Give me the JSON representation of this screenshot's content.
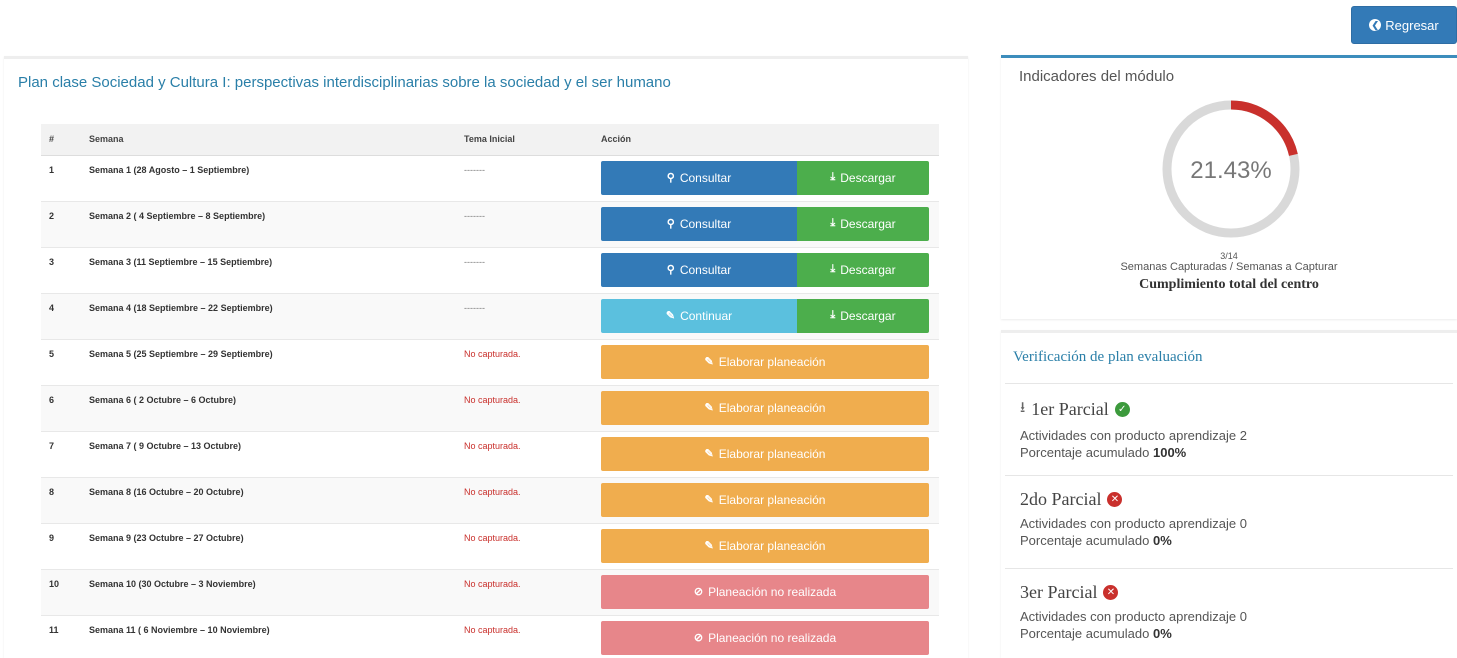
{
  "header": {
    "back_label": "Regresar"
  },
  "plan": {
    "title": "Plan clase Sociedad y Cultura I: perspectivas interdisciplinarias sobre la sociedad y el ser humano",
    "columns": [
      "#",
      "Semana",
      "Tema Inicial",
      "Acción"
    ],
    "rows": [
      {
        "num": "1",
        "semana": "Semana 1 (28 Agosto – 1 Septiembre)",
        "tema": "-------",
        "actions": [
          "consultar",
          "descargar"
        ]
      },
      {
        "num": "2",
        "semana": "Semana 2 ( 4 Septiembre – 8 Septiembre)",
        "tema": "-------",
        "actions": [
          "consultar",
          "descargar"
        ]
      },
      {
        "num": "3",
        "semana": "Semana 3 (11 Septiembre – 15 Septiembre)",
        "tema": "-------",
        "actions": [
          "consultar",
          "descargar"
        ]
      },
      {
        "num": "4",
        "semana": "Semana 4 (18 Septiembre – 22 Septiembre)",
        "tema": "-------",
        "actions": [
          "continuar",
          "descargar"
        ]
      },
      {
        "num": "5",
        "semana": "Semana 5 (25 Septiembre – 29 Septiembre)",
        "tema": "No capturada.",
        "actions": [
          "elaborar"
        ]
      },
      {
        "num": "6",
        "semana": "Semana 6 ( 2 Octubre – 6 Octubre)",
        "tema": "No capturada.",
        "actions": [
          "elaborar"
        ]
      },
      {
        "num": "7",
        "semana": "Semana 7 ( 9 Octubre – 13 Octubre)",
        "tema": "No capturada.",
        "actions": [
          "elaborar"
        ]
      },
      {
        "num": "8",
        "semana": "Semana 8 (16 Octubre – 20 Octubre)",
        "tema": "No capturada.",
        "actions": [
          "elaborar"
        ]
      },
      {
        "num": "9",
        "semana": "Semana 9 (23 Octubre – 27 Octubre)",
        "tema": "No capturada.",
        "actions": [
          "elaborar"
        ]
      },
      {
        "num": "10",
        "semana": "Semana 10 (30 Octubre – 3 Noviembre)",
        "tema": "No capturada.",
        "actions": [
          "no_realizada"
        ]
      },
      {
        "num": "11",
        "semana": "Semana 11 ( 6 Noviembre – 10 Noviembre)",
        "tema": "No capturada.",
        "actions": [
          "no_realizada"
        ]
      }
    ],
    "labels": {
      "consultar": "Consultar",
      "descargar": "Descargar",
      "continuar": "Continuar",
      "elaborar": "Elaborar planeación",
      "no_realizada": "Planeación no realizada"
    }
  },
  "indicadores": {
    "title": "Indicadores del módulo",
    "percent_text": "21.43%",
    "percent_value": 0.2143,
    "fraction": "3/14",
    "subtitle": "Semanas Capturadas / Semanas a Capturar",
    "bold_label": "Cumplimiento total del centro",
    "colors": {
      "track": "#d9d9d9",
      "fill": "#c9302c"
    }
  },
  "verificacion": {
    "title": "Verificación de plan evaluación",
    "parciales": [
      {
        "name": "1er Parcial",
        "status": "ok",
        "actividades_label": "Actividades con producto aprendizaje",
        "actividades": "2",
        "porcentaje_label": "Porcentaje acumulado",
        "porcentaje": "100%"
      },
      {
        "name": "2do Parcial",
        "status": "no",
        "actividades_label": "Actividades con producto aprendizaje",
        "actividades": "0",
        "porcentaje_label": "Porcentaje acumulado",
        "porcentaje": "0%"
      },
      {
        "name": "3er Parcial",
        "status": "no",
        "actividades_label": "Actividades con producto aprendizaje",
        "actividades": "0",
        "porcentaje_label": "Porcentaje acumulado",
        "porcentaje": "0%"
      }
    ]
  }
}
